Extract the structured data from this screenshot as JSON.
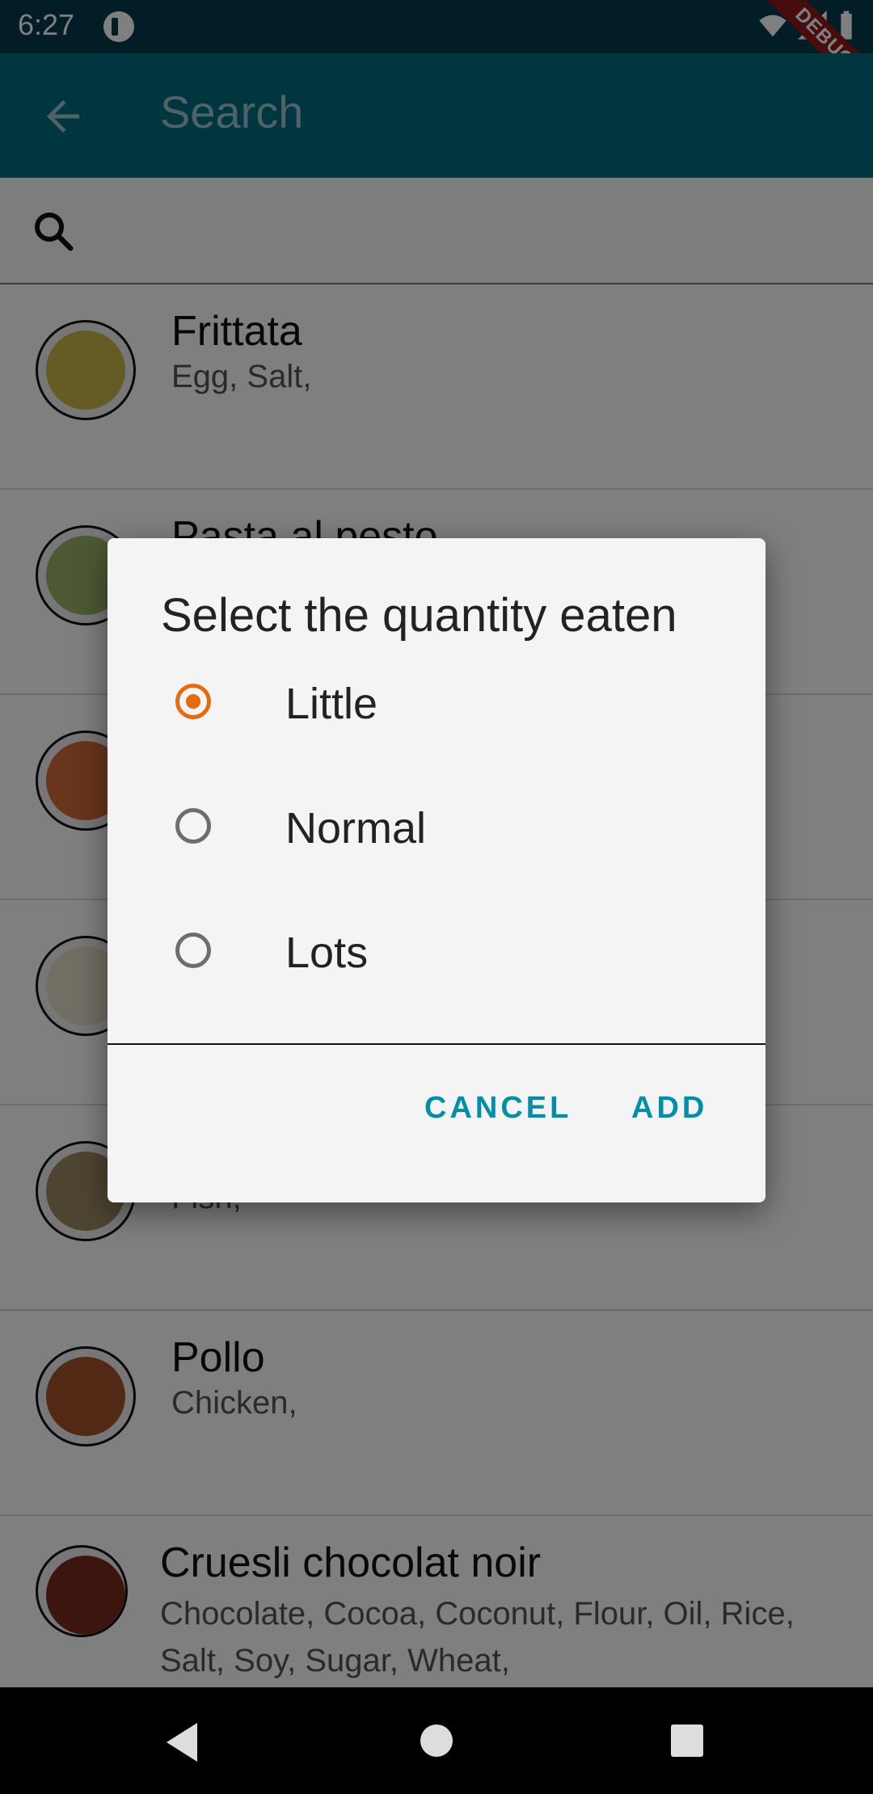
{
  "status_bar": {
    "time": "6:27",
    "debug_label": "DEBUG"
  },
  "app_bar": {
    "title": "Search"
  },
  "list": {
    "items": [
      {
        "title": "Frittata",
        "subtitle": "Egg, Salt,"
      },
      {
        "title": "Pasta al pesto",
        "subtitle": ""
      },
      {
        "title": "",
        "subtitle": ""
      },
      {
        "title": "",
        "subtitle": ""
      },
      {
        "title": "",
        "subtitle": "Fish,"
      },
      {
        "title": "Pollo",
        "subtitle": "Chicken,"
      },
      {
        "title": "Cruesli chocolat noir",
        "subtitle": "Chocolate, Cocoa, Coconut, Flour, Oil, Rice, Salt, Soy, Sugar, Wheat,"
      }
    ]
  },
  "dialog": {
    "title": "Select the quantity eaten",
    "options": [
      {
        "label": "Little",
        "selected": true
      },
      {
        "label": "Normal",
        "selected": false
      },
      {
        "label": "Lots",
        "selected": false
      }
    ],
    "cancel_label": "CANCEL",
    "add_label": "ADD"
  },
  "colors": {
    "app_bar": "#006c80",
    "status_bar": "#053b4a",
    "accent_radio": "#e56b0f",
    "button_text": "#008fa6",
    "debug_banner": "#8e1b1b"
  },
  "icons": [
    "back-arrow-icon",
    "search-icon",
    "wifi-icon",
    "signal-icon",
    "battery-icon",
    "nav-back-icon",
    "nav-home-icon",
    "nav-recents-icon"
  ]
}
